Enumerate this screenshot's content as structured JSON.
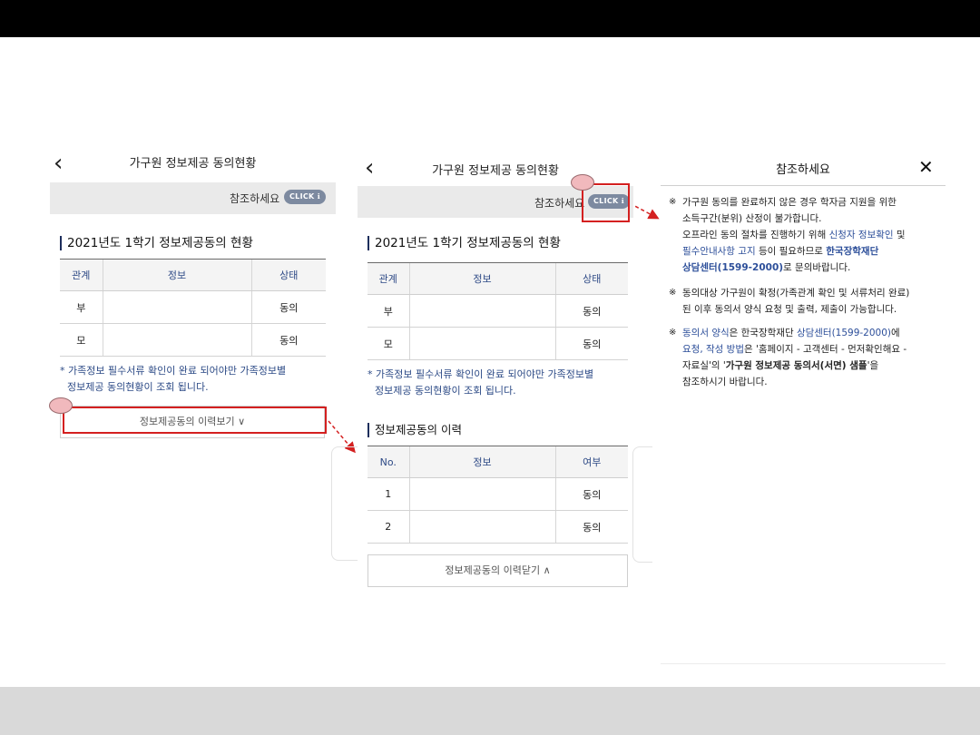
{
  "panel1": {
    "back_icon": "‹",
    "title": "가구원 정보제공 동의현황",
    "notice_text": "참조하세요",
    "click_badge": "CLICK ℹ",
    "section_title": "2021년도 1학기 정보제공동의 현황",
    "table": {
      "headers": [
        "관계",
        "정보",
        "상태"
      ],
      "rows": [
        [
          "부",
          "",
          "동의"
        ],
        [
          "모",
          "",
          "동의"
        ]
      ]
    },
    "footnote_1": "* 가족정보 필수서류 확인이 완료 되어야만 가족정보별",
    "footnote_2": "정보제공 동의현황이 조회 됩니다.",
    "history_button": "정보제공동의 이력보기 ∨"
  },
  "panel2": {
    "back_icon": "‹",
    "title": "가구원 정보제공 동의현황",
    "notice_text": "참조하세요",
    "click_badge": "CLICK ℹ",
    "section_title": "2021년도 1학기 정보제공동의 현황",
    "table": {
      "headers": [
        "관계",
        "정보",
        "상태"
      ],
      "rows": [
        [
          "부",
          "",
          "동의"
        ],
        [
          "모",
          "",
          "동의"
        ]
      ]
    },
    "footnote_1": "* 가족정보 필수서류 확인이 완료 되어야만 가족정보별",
    "footnote_2": "정보제공 동의현황이 조회 됩니다.",
    "history_title": "정보제공동의 이력",
    "history_table": {
      "headers": [
        "No.",
        "정보",
        "여부"
      ],
      "rows": [
        [
          "1",
          "",
          "동의"
        ],
        [
          "2",
          "",
          "동의"
        ]
      ]
    },
    "history_close_button": "정보제공동의 이력닫기 ∧"
  },
  "popup": {
    "title": "참조하세요",
    "close_icon": "✕",
    "bullet_mark": "※",
    "b1": {
      "l1": "가구원 동의를 완료하지 않은 경우 학자금 지원을 위한",
      "l2": "소득구간(분위) 산정이 불가합니다.",
      "l3a": "오프라인 동의 절차를 진행하기 위해 ",
      "l3b": "신청자 정보확인",
      "l3c": " 및",
      "l4a": "필수안내사항 고지",
      "l4b": " 등이 필요하므로 ",
      "l4c": "한국장학재단",
      "l5a": "상담센터(1599-2000)",
      "l5b": "로 문의바랍니다."
    },
    "b2": {
      "l1": "동의대상 가구원이 확정(가족관계 확인 및 서류처리 완료)",
      "l2": "된 이후 동의서 양식 요청 및 출력, 제출이 가능합니다."
    },
    "b3": {
      "l1a": "동의서 양식",
      "l1b": "은 한국장학재단 ",
      "l1c": "상담센터(1599-2000)",
      "l1d": "에",
      "l2a": "요청, 작성 방법",
      "l2b": "은 '홈페이지 - 고객센터 - 먼저확인해요 -",
      "l3a": "자료실'의 '",
      "l3b": "가구원 정보제공 동의서(서면) 샘플",
      "l3c": "'을",
      "l4": "참조하시기 바랍니다."
    }
  }
}
